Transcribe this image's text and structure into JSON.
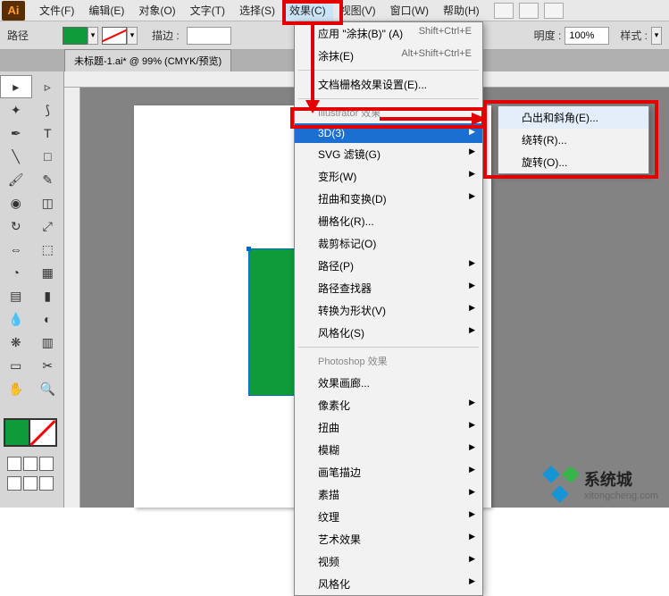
{
  "menubar": {
    "logo": "Ai",
    "items": [
      "文件(F)",
      "编辑(E)",
      "对象(O)",
      "文字(T)",
      "选择(S)",
      "效果(C)",
      "视图(V)",
      "窗口(W)",
      "帮助(H)"
    ],
    "active_index": 5
  },
  "controlbar": {
    "path_label": "路径",
    "stroke_label": "描边 :",
    "opacity_label": "明度 :",
    "opacity_value": "100%",
    "style_label": "样式 :"
  },
  "doc_tab": "未标题-1.ai* @ 99% (CMYK/预览)",
  "effects_menu": {
    "apply": "应用 \"涂抹(B)\" (A)",
    "apply_shortcut": "Shift+Ctrl+E",
    "smear": "涂抹(E)",
    "smear_shortcut": "Alt+Shift+Ctrl+E",
    "raster_settings": "文档栅格效果设置(E)...",
    "illustrator_header": "Illustrator 效果",
    "items_il": [
      {
        "label": "3D(3)",
        "arrow": true
      },
      {
        "label": "SVG 滤镜(G)",
        "arrow": true
      },
      {
        "label": "变形(W)",
        "arrow": true
      },
      {
        "label": "扭曲和变换(D)",
        "arrow": true
      },
      {
        "label": "栅格化(R)...",
        "arrow": false
      },
      {
        "label": "裁剪标记(O)",
        "arrow": false
      },
      {
        "label": "路径(P)",
        "arrow": true
      },
      {
        "label": "路径查找器",
        "arrow": true
      },
      {
        "label": "转换为形状(V)",
        "arrow": true
      },
      {
        "label": "风格化(S)",
        "arrow": true
      }
    ],
    "photoshop_header": "Photoshop 效果",
    "items_ps": [
      "效果画廊...",
      "像素化",
      "扭曲",
      "模糊",
      "画笔描边",
      "素描",
      "纹理",
      "艺术效果",
      "视频",
      "风格化"
    ]
  },
  "submenu_3d": {
    "items": [
      "凸出和斜角(E)...",
      "绕转(R)...",
      "旋转(O)..."
    ]
  },
  "watermark": {
    "title": "系统城",
    "url": "xitongcheng.com"
  }
}
